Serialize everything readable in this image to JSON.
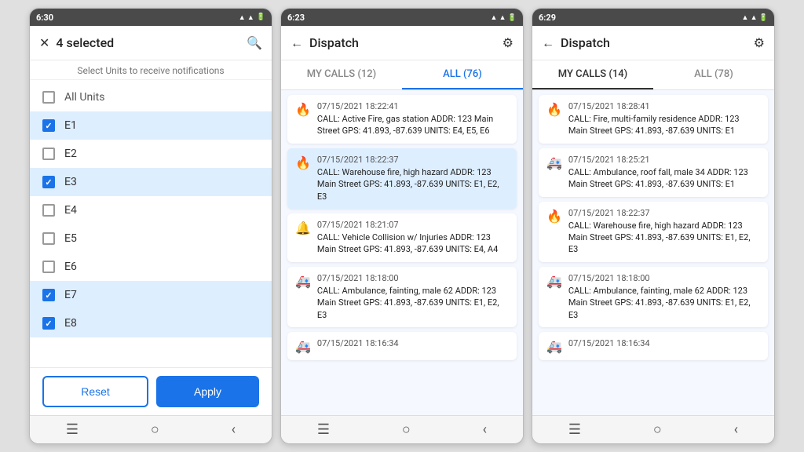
{
  "panel1": {
    "statusBar": {
      "time": "6:30",
      "icons": "📶 📶 🔋"
    },
    "title": "4 selected",
    "subtitle": "Select Units to receive notifications",
    "searchIcon": "🔍",
    "closeIcon": "✕",
    "units": [
      {
        "id": "all",
        "label": "All Units",
        "checked": false
      },
      {
        "id": "e1",
        "label": "E1",
        "checked": true
      },
      {
        "id": "e2",
        "label": "E2",
        "checked": false
      },
      {
        "id": "e3",
        "label": "E3",
        "checked": true
      },
      {
        "id": "e4",
        "label": "E4",
        "checked": false
      },
      {
        "id": "e5",
        "label": "E5",
        "checked": false
      },
      {
        "id": "e6",
        "label": "E6",
        "checked": false
      },
      {
        "id": "e7",
        "label": "E7",
        "checked": true
      },
      {
        "id": "e8",
        "label": "E8",
        "checked": true
      }
    ],
    "resetLabel": "Reset",
    "applyLabel": "Apply"
  },
  "panel2": {
    "statusBar": {
      "time": "6:23"
    },
    "title": "Dispatch",
    "tabs": [
      {
        "id": "my-calls",
        "label": "MY CALLS (12)",
        "active": false
      },
      {
        "id": "all",
        "label": "ALL (76)",
        "active": true
      }
    ],
    "calls": [
      {
        "time": "07/15/2021 18:22:41",
        "icon": "🔥",
        "text": "CALL: Active Fire, gas station   ADDR: 123 Main Street  GPS: 41.893, -87.639  UNITS: E4, E5, E6",
        "highlighted": false
      },
      {
        "time": "07/15/2021 18:22:37",
        "icon": "🔥",
        "text": "CALL: Warehouse fire, high hazard  ADDR: 123 Main Street  GPS: 41.893, -87.639  UNITS: E1, E2, E3",
        "highlighted": true
      },
      {
        "time": "07/15/2021 18:21:07",
        "icon": "🔔",
        "text": "CALL: Vehicle Collision w/ Injuries  ADDR: 123 Main Street  GPS: 41.893, -87.639  UNITS: E4, A4",
        "highlighted": false
      },
      {
        "time": "07/15/2021 18:18:00",
        "icon": "🚑",
        "text": "CALL: Ambulance, fainting, male 62  ADDR: 123 Main Street  GPS: 41.893, -87.639  UNITS: E1, E2, E3",
        "highlighted": false
      },
      {
        "time": "07/15/2021 18:16:34",
        "icon": "🚑",
        "text": "",
        "highlighted": false
      }
    ]
  },
  "panel3": {
    "statusBar": {
      "time": "6:29"
    },
    "title": "Dispatch",
    "tabs": [
      {
        "id": "my-calls",
        "label": "MY CALLS (14)",
        "active": true
      },
      {
        "id": "all",
        "label": "ALL (78)",
        "active": false
      }
    ],
    "calls": [
      {
        "time": "07/15/2021 18:28:41",
        "icon": "🔥",
        "text": "CALL: Fire, multi-family residence  ADDR: 123 Main Street  GPS: 41.893, -87.639  UNITS: E1",
        "highlighted": false
      },
      {
        "time": "07/15/2021 18:25:21",
        "icon": "🚑",
        "text": "CALL: Ambulance, roof fall, male 34  ADDR: 123 Main Street  GPS: 41.893, -87.639  UNITS: E1",
        "highlighted": false
      },
      {
        "time": "07/15/2021 18:22:37",
        "icon": "🔥",
        "text": "CALL: Warehouse fire, high hazard  ADDR: 123 Main Street  GPS: 41.893, -87.639  UNITS: E1, E2, E3",
        "highlighted": false
      },
      {
        "time": "07/15/2021 18:18:00",
        "icon": "🚑",
        "text": "CALL: Ambulance, fainting, male 62  ADDR: 123 Main Street  GPS: 41.893, -87.639  UNITS: E1, E2, E3",
        "highlighted": false
      },
      {
        "time": "07/15/2021 18:16:34",
        "icon": "🚑",
        "text": "",
        "highlighted": false
      }
    ]
  }
}
